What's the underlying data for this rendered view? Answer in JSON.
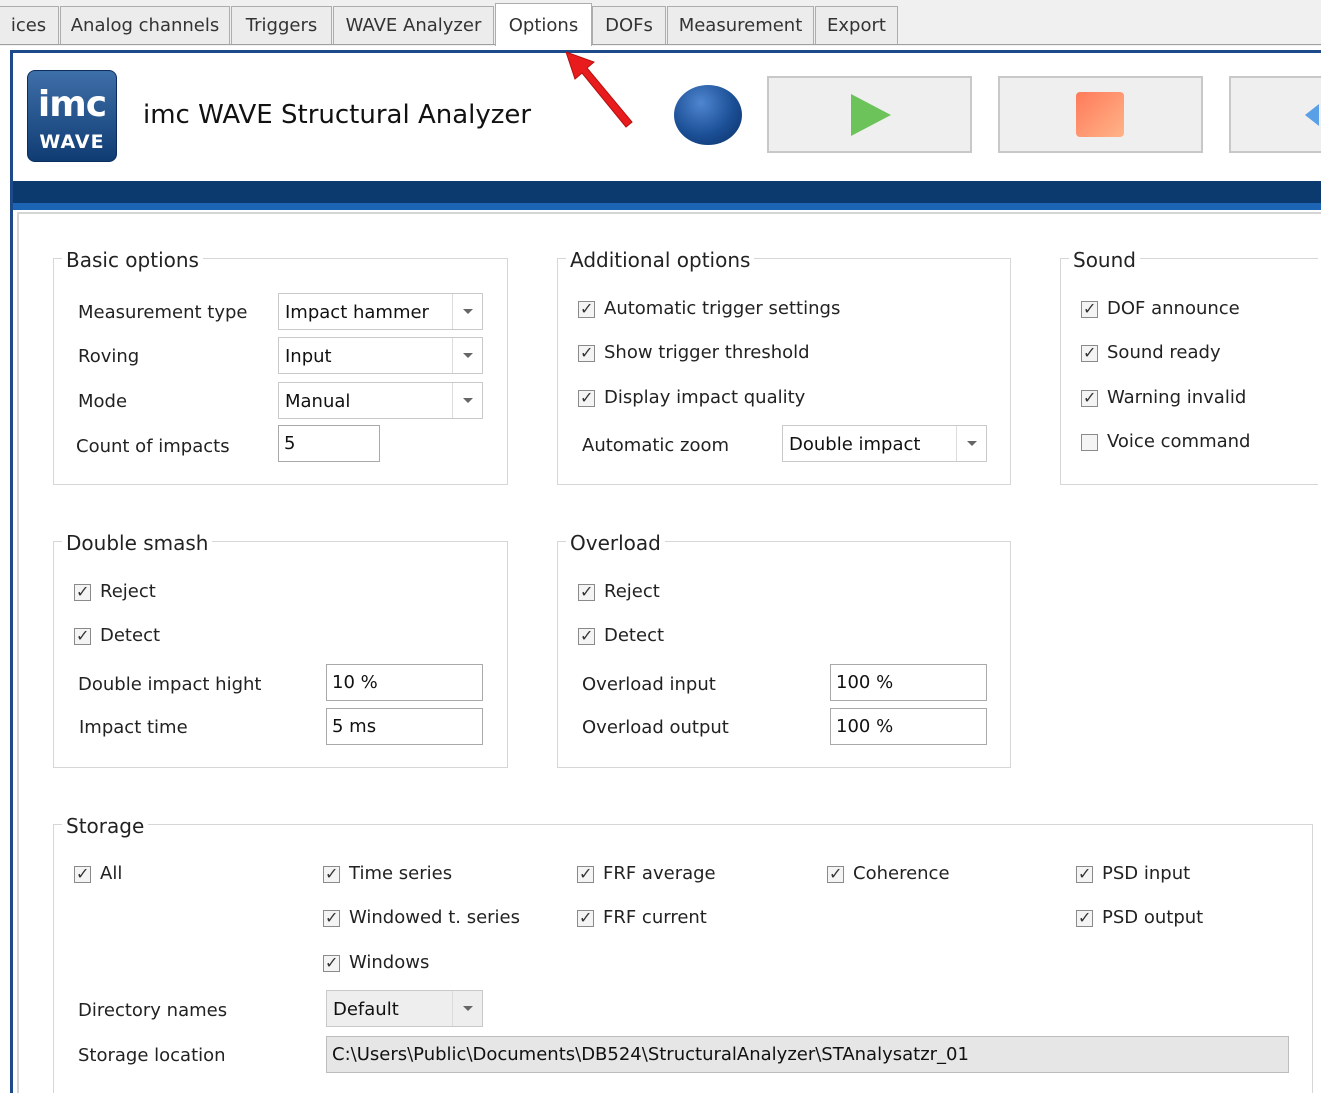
{
  "tabs": [
    {
      "label": "ices",
      "active": false
    },
    {
      "label": "Analog channels",
      "active": false
    },
    {
      "label": "Triggers",
      "active": false
    },
    {
      "label": "WAVE Analyzer",
      "active": false
    },
    {
      "label": "Options",
      "active": true
    },
    {
      "label": "DOFs",
      "active": false
    },
    {
      "label": "Measurement",
      "active": false
    },
    {
      "label": "Export",
      "active": false
    }
  ],
  "header": {
    "logo_top": "imc",
    "logo_bottom": "WAVE",
    "title": "imc WAVE Structural Analyzer"
  },
  "basic_options": {
    "title": "Basic options",
    "measurement_type": {
      "label": "Measurement type",
      "value": "Impact hammer"
    },
    "roving": {
      "label": "Roving",
      "value": "Input"
    },
    "mode": {
      "label": "Mode",
      "value": "Manual"
    },
    "count_of_impacts": {
      "label": "Count of impacts",
      "value": "5"
    }
  },
  "additional_options": {
    "title": "Additional options",
    "automatic_trigger_settings": {
      "label": "Automatic trigger settings",
      "checked": true
    },
    "show_trigger_threshold": {
      "label": "Show trigger threshold",
      "checked": true
    },
    "display_impact_quality": {
      "label": "Display impact quality",
      "checked": true
    },
    "automatic_zoom": {
      "label": "Automatic zoom",
      "value": "Double impact"
    }
  },
  "sound": {
    "title": "Sound",
    "dof_announce": {
      "label": "DOF announce",
      "checked": true
    },
    "sound_ready": {
      "label": "Sound ready",
      "checked": true
    },
    "warning_invalid": {
      "label": "Warning invalid",
      "checked": true
    },
    "voice_command": {
      "label": "Voice command",
      "checked": false
    }
  },
  "double_smash": {
    "title": "Double smash",
    "reject": {
      "label": "Reject",
      "checked": true
    },
    "detect": {
      "label": "Detect",
      "checked": true
    },
    "double_impact_hight": {
      "label": "Double impact hight",
      "value": "10 %"
    },
    "impact_time": {
      "label": "Impact time",
      "value": "5 ms"
    }
  },
  "overload": {
    "title": "Overload",
    "reject": {
      "label": "Reject",
      "checked": true
    },
    "detect": {
      "label": "Detect",
      "checked": true
    },
    "overload_input": {
      "label": "Overload input",
      "value": "100 %"
    },
    "overload_output": {
      "label": "Overload output",
      "value": "100 %"
    }
  },
  "storage": {
    "title": "Storage",
    "all": {
      "label": "All",
      "checked": true
    },
    "time_series": {
      "label": "Time series",
      "checked": true
    },
    "windowed_t_series": {
      "label": "Windowed t. series",
      "checked": true
    },
    "windows": {
      "label": "Windows",
      "checked": true
    },
    "frf_average": {
      "label": "FRF average",
      "checked": true
    },
    "frf_current": {
      "label": "FRF current",
      "checked": true
    },
    "coherence": {
      "label": "Coherence",
      "checked": true
    },
    "psd_input": {
      "label": "PSD input",
      "checked": true
    },
    "psd_output": {
      "label": "PSD output",
      "checked": true
    },
    "directory_names": {
      "label": "Directory names",
      "value": "Default"
    },
    "storage_location": {
      "label": "Storage location",
      "value": "C:\\Users\\Public\\Documents\\DB524\\StructuralAnalyzer\\STAnalysatzr_01"
    }
  },
  "colors": {
    "frame_blue": "#1c4a8a",
    "bar_dark_blue": "#0c3a6e",
    "play_green": "#6cc35a",
    "stop_orange": "#ff7a5a",
    "annotation_arrow": "#e81c1c"
  }
}
